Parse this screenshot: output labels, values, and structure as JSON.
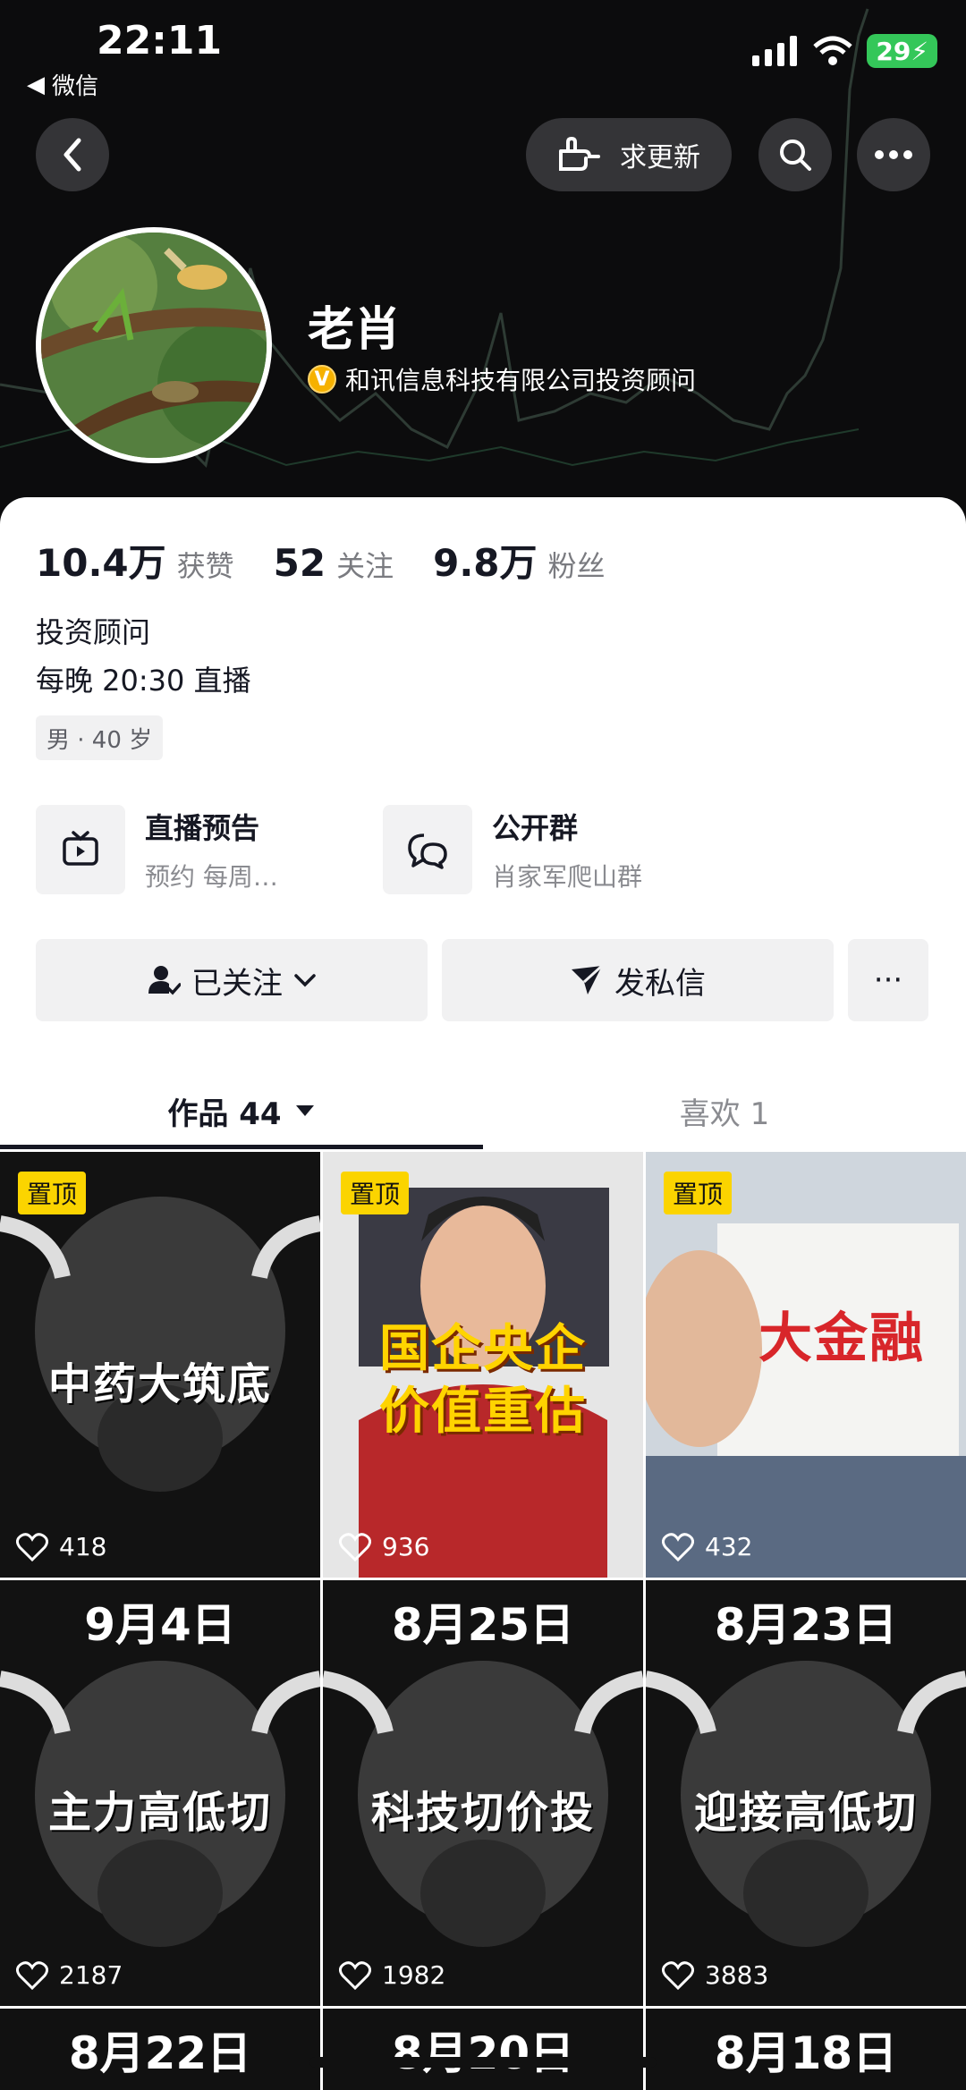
{
  "status": {
    "time": "22:11",
    "back_app": "微信",
    "battery": "29"
  },
  "nav": {
    "request_update": "求更新"
  },
  "profile": {
    "name": "老肖",
    "verified_text": "和讯信息科技有限公司投资顾问",
    "verified_badge": "V"
  },
  "stats": [
    {
      "num": "10.4万",
      "label": "获赞"
    },
    {
      "num": "52",
      "label": "关注"
    },
    {
      "num": "9.8万",
      "label": "粉丝"
    }
  ],
  "bio": {
    "line1": "投资顾问",
    "line2": "每晚 20:30 直播"
  },
  "tag": "男 · 40 岁",
  "features": [
    {
      "title": "直播预告",
      "sub": "预约 每周…",
      "icon": "tv-icon"
    },
    {
      "title": "公开群",
      "sub": "肖家军爬山群",
      "icon": "chat-group-icon"
    }
  ],
  "actions": {
    "following": "已关注",
    "message": "发私信",
    "more": "···"
  },
  "tabs": {
    "works": "作品 44",
    "likes": "喜欢 1"
  },
  "videos": [
    {
      "pinned": "置顶",
      "likes": "418",
      "caption": "中药大筑底",
      "date": ""
    },
    {
      "pinned": "置顶",
      "likes": "936",
      "caption": "国企央企\n价值重估",
      "date": ""
    },
    {
      "pinned": "置顶",
      "likes": "432",
      "caption": "大金融",
      "date": ""
    },
    {
      "pinned": "",
      "likes": "2187",
      "caption": "主力高低切",
      "date": "9月4日"
    },
    {
      "pinned": "",
      "likes": "1982",
      "caption": "科技切价投",
      "date": "8月25日"
    },
    {
      "pinned": "",
      "likes": "3883",
      "caption": "迎接高低切",
      "date": "8月23日"
    },
    {
      "pinned": "",
      "likes": "",
      "caption": "",
      "date": "8月22日"
    },
    {
      "pinned": "",
      "likes": "",
      "caption": "",
      "date": "8月20日"
    },
    {
      "pinned": "",
      "likes": "",
      "caption": "",
      "date": "8月18日"
    }
  ],
  "colors": {
    "pin_bg": "#fbd400",
    "battery": "#34c759",
    "header_bg": "#0c0c0d"
  }
}
